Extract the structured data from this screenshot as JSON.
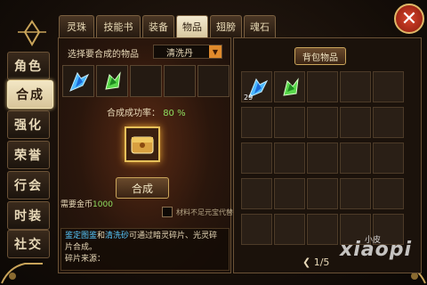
{
  "top_tabs": [
    {
      "label": "灵珠",
      "active": false
    },
    {
      "label": "技能书",
      "active": false
    },
    {
      "label": "装备",
      "active": false
    },
    {
      "label": "物品",
      "active": true
    },
    {
      "label": "翅膀",
      "active": false
    },
    {
      "label": "魂石",
      "active": false
    }
  ],
  "side_tabs": [
    {
      "label": "角色",
      "active": false
    },
    {
      "label": "合成",
      "active": true
    },
    {
      "label": "强化",
      "active": false
    },
    {
      "label": "荣誉",
      "active": false
    },
    {
      "label": "行会",
      "active": false
    },
    {
      "label": "时装",
      "active": false
    },
    {
      "label": "社交",
      "active": false
    }
  ],
  "synth": {
    "select_label": "选择要合成的物品",
    "selected_item": "清洗丹",
    "rate_label": "合成成功率：",
    "rate_value": "80 %",
    "compose_button": "合成",
    "cost_label": "需要金币",
    "cost_value": "1000",
    "checkbox_label": "材料不足元宝代替",
    "materials": [
      "blue-crystal",
      "green-crystal",
      "",
      "",
      ""
    ],
    "note": {
      "p1": "鉴定图鉴",
      "p2": "和",
      "p3": "清洗砂",
      "p4": "可通过暗灵碎片、光灵碎片合成。",
      "source_label": "碎片来源："
    }
  },
  "bag": {
    "title": "背包物品",
    "items": [
      {
        "icon": "blue-crystal",
        "count": "29"
      },
      {
        "icon": "green-crystal",
        "count": ""
      }
    ],
    "page": "1/5"
  },
  "watermark": {
    "big": "xiaopi",
    "small": "小皮"
  },
  "colors": {
    "accent_gold": "#c9a45a",
    "rate_green": "#8fe060",
    "highlight_blue": "#58c8ff",
    "close_red": "#d8442c"
  }
}
